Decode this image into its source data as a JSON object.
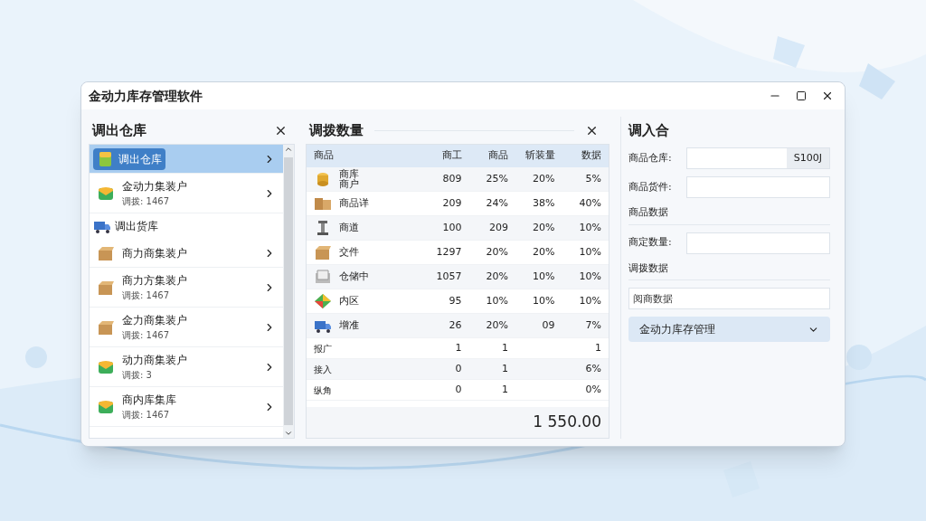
{
  "window": {
    "title": "金动力库存管理软件"
  },
  "left_panel": {
    "title": "调出仓库",
    "items": [
      {
        "kind": "item",
        "label": "调出仓库",
        "selected": true
      },
      {
        "kind": "item",
        "label": "金动力集装户",
        "sub": "调拨: 1467",
        "selected": false
      },
      {
        "kind": "header",
        "label": "调出货库"
      },
      {
        "kind": "item",
        "label": "商力商集装户",
        "selected": false
      },
      {
        "kind": "item",
        "label": "商力方集装户",
        "sub": "调拨: 1467",
        "selected": false
      },
      {
        "kind": "item",
        "label": "金力商集装户",
        "sub": "调拨: 1467",
        "selected": false
      },
      {
        "kind": "item",
        "label": "动力商集装户",
        "sub": "调拨: 3",
        "selected": false
      },
      {
        "kind": "item",
        "label": "商内库集库",
        "sub": "调拨: 1467",
        "selected": false
      }
    ]
  },
  "middle_panel": {
    "title": "调拨数量",
    "table": {
      "columns": [
        "商品",
        "商工",
        "商品",
        "斩装量",
        "数据"
      ],
      "rows": [
        {
          "kind": "product",
          "cells": [
            "商库商户",
            "809",
            "25%",
            "20%",
            "5%"
          ]
        },
        {
          "kind": "product",
          "cells": [
            "商品详",
            "209",
            "24%",
            "38%",
            "40%"
          ]
        },
        {
          "kind": "product",
          "cells": [
            "商道",
            "100",
            "209",
            "20%",
            "10%"
          ]
        },
        {
          "kind": "product",
          "cells": [
            "交件",
            "1297",
            "20%",
            "20%",
            "10%"
          ]
        },
        {
          "kind": "product",
          "cells": [
            "仓储中",
            "1057",
            "20%",
            "10%",
            "10%"
          ]
        },
        {
          "kind": "product",
          "cells": [
            "内区",
            "95",
            "10%",
            "10%",
            "10%"
          ]
        },
        {
          "kind": "product",
          "cells": [
            "增准",
            "26",
            "20%",
            "09",
            "7%"
          ]
        },
        {
          "kind": "plain",
          "cells": [
            "报广",
            "1",
            "1",
            "",
            "1"
          ]
        },
        {
          "kind": "plain",
          "cells": [
            "接入",
            "0",
            "1",
            "",
            "6%"
          ]
        },
        {
          "kind": "plain",
          "cells": [
            "纵角",
            "0",
            "1",
            "",
            "0%"
          ]
        }
      ],
      "total": "1 550.00"
    }
  },
  "right_panel": {
    "title": "调入合",
    "rows": [
      {
        "kind": "field",
        "label": "商品仓库:",
        "suffix": "S100J"
      },
      {
        "kind": "field",
        "label": "商品货件:"
      },
      {
        "kind": "section",
        "label": "商品数据"
      },
      {
        "kind": "field",
        "label": "商定数量:"
      },
      {
        "kind": "section",
        "label": "调拨数据"
      },
      {
        "kind": "input",
        "placeholder": "阅商数据"
      },
      {
        "kind": "select",
        "value": "金动力库存管理"
      }
    ]
  }
}
